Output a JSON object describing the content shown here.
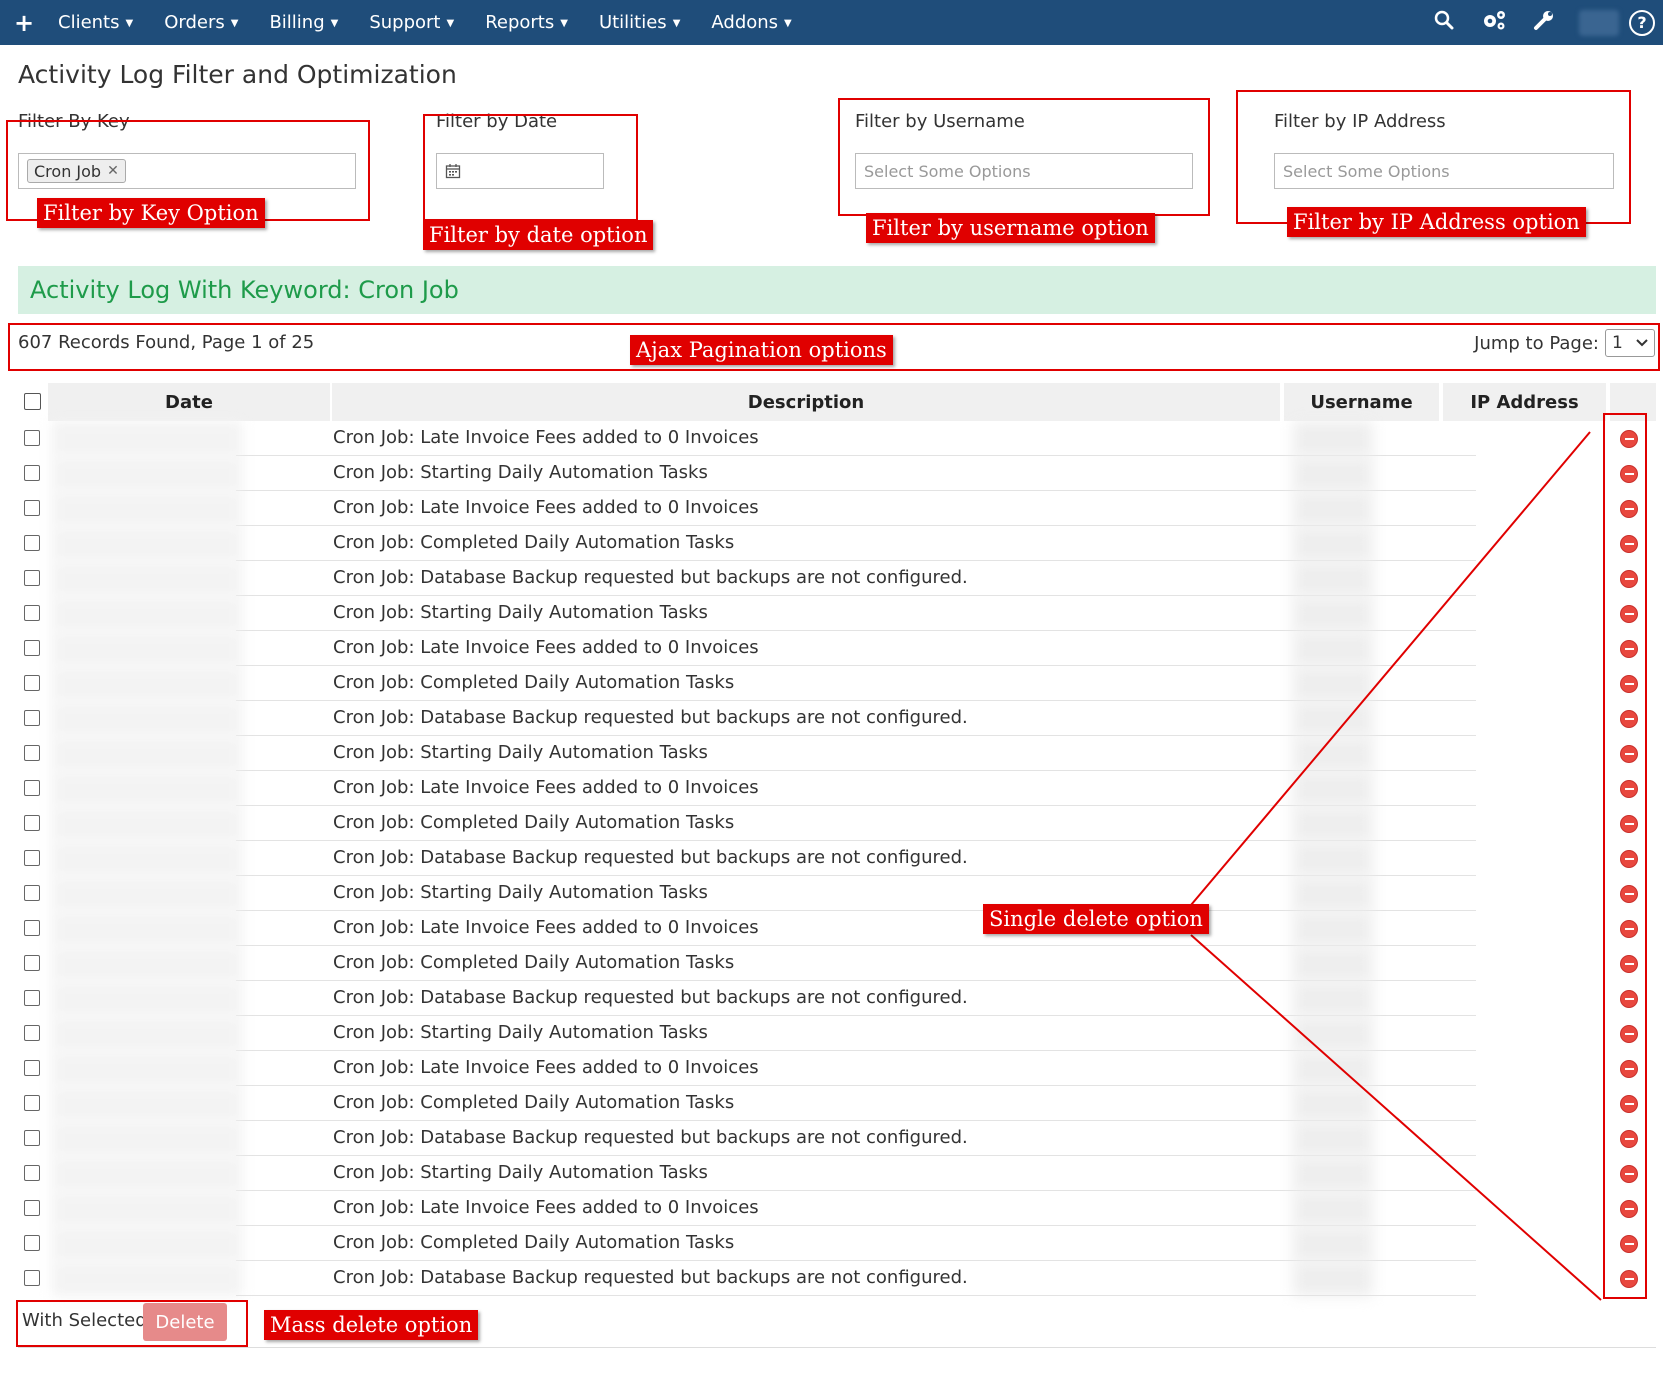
{
  "nav": {
    "plus": "+",
    "items": [
      "Clients",
      "Orders",
      "Billing",
      "Support",
      "Reports",
      "Utilities",
      "Addons"
    ],
    "right_icons": [
      "search-icon",
      "gears-icon",
      "wrench-icon",
      "avatar",
      "help-icon"
    ],
    "help_glyph": "?"
  },
  "page": {
    "title": "Activity Log Filter and Optimization"
  },
  "filters": {
    "key": {
      "label": "Filter By Key",
      "tag": "Cron Job",
      "tag_remove": "✕"
    },
    "date": {
      "label": "Filter by Date"
    },
    "username": {
      "label": "Filter by Username",
      "placeholder": "Select Some Options"
    },
    "ip": {
      "label": "Filter by IP Address",
      "placeholder": "Select Some Options"
    }
  },
  "annotations": {
    "key": "Filter by Key Option",
    "date": "Filter by date option",
    "username": "Filter by username option",
    "ip": "Filter by IP Address option",
    "pagination": "Ajax Pagination options",
    "single_delete": "Single delete option",
    "mass_delete": "Mass delete option"
  },
  "banner": {
    "text": "Activity Log With Keyword: Cron Job"
  },
  "pagination": {
    "records": "607 Records Found, Page 1 of 25",
    "jump_label": "Jump to Page:",
    "page_value": "1"
  },
  "table": {
    "headers": {
      "date": "Date",
      "description": "Description",
      "username": "Username",
      "ip": "IP Address"
    },
    "rows": [
      "Cron Job: Late Invoice Fees added to 0 Invoices",
      "Cron Job: Starting Daily Automation Tasks",
      "Cron Job: Late Invoice Fees added to 0 Invoices",
      "Cron Job: Completed Daily Automation Tasks",
      "Cron Job: Database Backup requested but backups are not configured.",
      "Cron Job: Starting Daily Automation Tasks",
      "Cron Job: Late Invoice Fees added to 0 Invoices",
      "Cron Job: Completed Daily Automation Tasks",
      "Cron Job: Database Backup requested but backups are not configured.",
      "Cron Job: Starting Daily Automation Tasks",
      "Cron Job: Late Invoice Fees added to 0 Invoices",
      "Cron Job: Completed Daily Automation Tasks",
      "Cron Job: Database Backup requested but backups are not configured.",
      "Cron Job: Starting Daily Automation Tasks",
      "Cron Job: Late Invoice Fees added to 0 Invoices",
      "Cron Job: Completed Daily Automation Tasks",
      "Cron Job: Database Backup requested but backups are not configured.",
      "Cron Job: Starting Daily Automation Tasks",
      "Cron Job: Late Invoice Fees added to 0 Invoices",
      "Cron Job: Completed Daily Automation Tasks",
      "Cron Job: Database Backup requested but backups are not configured.",
      "Cron Job: Starting Daily Automation Tasks",
      "Cron Job: Late Invoice Fees added to 0 Invoices",
      "Cron Job: Completed Daily Automation Tasks",
      "Cron Job: Database Backup requested but backups are not configured."
    ]
  },
  "mass_actions": {
    "label": "With Selected:",
    "delete": "Delete"
  },
  "colors": {
    "nav_bg": "#1f4d7a",
    "annotation": "#e00000",
    "banner_bg": "#d6f0e2",
    "banner_text": "#1e9b4a",
    "delete_icon": "#e8473e",
    "delete_button": "#e68a8a"
  }
}
